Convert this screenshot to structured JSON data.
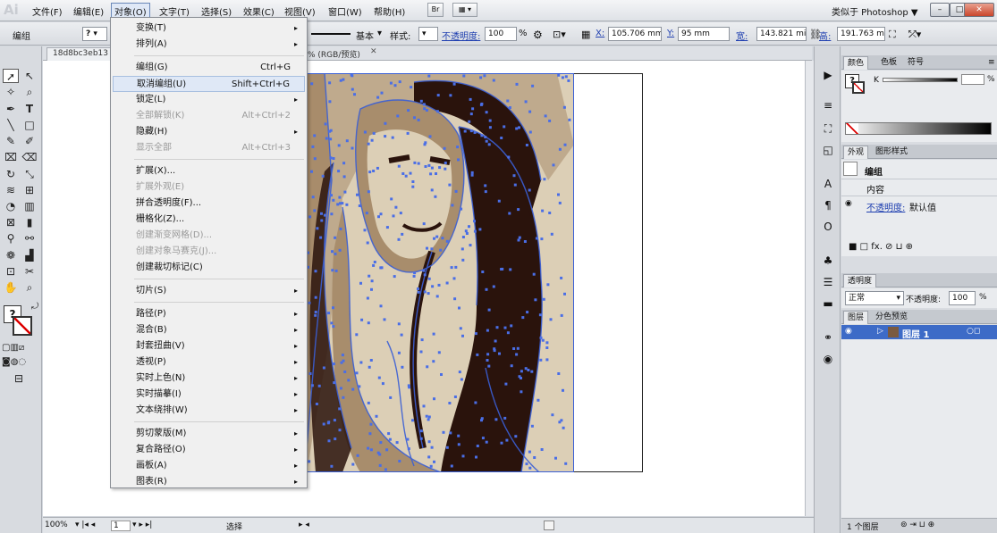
{
  "app": {
    "logo": "Ai",
    "workspace": "类似于 Photoshop ▼",
    "win_min": "–",
    "win_max": "□",
    "win_close": "✕"
  },
  "menubar": {
    "items": [
      "文件(F)",
      "编辑(E)",
      "对象(O)",
      "文字(T)",
      "选择(S)",
      "效果(C)",
      "视图(V)",
      "窗口(W)",
      "帮助(H)"
    ],
    "btn1": "Br",
    "btn2": "▦ ▾"
  },
  "control": {
    "group_label": "编组",
    "stroke_style": "基本",
    "style_label": "样式:",
    "opacity_label": "不透明度:",
    "opacity_value": "100",
    "opacity_unit": "%",
    "x_label": "X:",
    "x_value": "105.706 mm",
    "y_label": "Y:",
    "y_value": "95 mm",
    "w_label": "宽:",
    "w_value": "143.821 mi",
    "h_label": "高:",
    "h_value": "191.763 mi"
  },
  "document": {
    "tab_left": "18d8bc3eb13",
    "tab_right": "% (RGB/预览)",
    "tab_close": "✕"
  },
  "status": {
    "zoom": "100%",
    "page": "1",
    "mode": "选择"
  },
  "menu": {
    "items": [
      {
        "label": "变换(T)",
        "shortcut": "",
        "arrow": "▸",
        "state": "normal"
      },
      {
        "label": "排列(A)",
        "shortcut": "",
        "arrow": "▸",
        "state": "normal"
      },
      {
        "label": "编组(G)",
        "shortcut": "Ctrl+G",
        "arrow": "",
        "state": "normal"
      },
      {
        "label": "取消编组(U)",
        "shortcut": "Shift+Ctrl+G",
        "arrow": "",
        "state": "hi"
      },
      {
        "label": "锁定(L)",
        "shortcut": "",
        "arrow": "▸",
        "state": "normal"
      },
      {
        "label": "全部解锁(K)",
        "shortcut": "Alt+Ctrl+2",
        "arrow": "",
        "state": "dis"
      },
      {
        "label": "隐藏(H)",
        "shortcut": "",
        "arrow": "▸",
        "state": "normal"
      },
      {
        "label": "显示全部",
        "shortcut": "Alt+Ctrl+3",
        "arrow": "",
        "state": "dis"
      },
      {
        "label": "扩展(X)...",
        "shortcut": "",
        "arrow": "",
        "state": "normal"
      },
      {
        "label": "扩展外观(E)",
        "shortcut": "",
        "arrow": "",
        "state": "dis"
      },
      {
        "label": "拼合透明度(F)...",
        "shortcut": "",
        "arrow": "",
        "state": "normal"
      },
      {
        "label": "栅格化(Z)...",
        "shortcut": "",
        "arrow": "",
        "state": "normal"
      },
      {
        "label": "创建渐变网格(D)...",
        "shortcut": "",
        "arrow": "",
        "state": "dis"
      },
      {
        "label": "创建对象马赛克(J)...",
        "shortcut": "",
        "arrow": "",
        "state": "dis"
      },
      {
        "label": "创建裁切标记(C)",
        "shortcut": "",
        "arrow": "",
        "state": "normal"
      },
      {
        "label": "切片(S)",
        "shortcut": "",
        "arrow": "▸",
        "state": "normal"
      },
      {
        "label": "路径(P)",
        "shortcut": "",
        "arrow": "▸",
        "state": "normal"
      },
      {
        "label": "混合(B)",
        "shortcut": "",
        "arrow": "▸",
        "state": "normal"
      },
      {
        "label": "封套扭曲(V)",
        "shortcut": "",
        "arrow": "▸",
        "state": "normal"
      },
      {
        "label": "透视(P)",
        "shortcut": "",
        "arrow": "▸",
        "state": "normal"
      },
      {
        "label": "实时上色(N)",
        "shortcut": "",
        "arrow": "▸",
        "state": "normal"
      },
      {
        "label": "实时描摹(I)",
        "shortcut": "",
        "arrow": "▸",
        "state": "normal"
      },
      {
        "label": "文本绕排(W)",
        "shortcut": "",
        "arrow": "▸",
        "state": "normal"
      },
      {
        "label": "剪切蒙版(M)",
        "shortcut": "",
        "arrow": "▸",
        "state": "normal"
      },
      {
        "label": "复合路径(O)",
        "shortcut": "",
        "arrow": "▸",
        "state": "normal"
      },
      {
        "label": "画板(A)",
        "shortcut": "",
        "arrow": "▸",
        "state": "normal"
      },
      {
        "label": "图表(R)",
        "shortcut": "",
        "arrow": "▸",
        "state": "normal"
      }
    ]
  },
  "panels": {
    "color_tabs": [
      "颜色",
      "色板",
      "符号"
    ],
    "k_label": "K",
    "k_unit": "%",
    "appearance_tabs": [
      "外观",
      "图形样式"
    ],
    "appearance_group": "编组",
    "appearance_content": "内容",
    "appearance_opacity_label": "不透明度:",
    "appearance_opacity_value": "默认值",
    "transparency_tab": "透明度",
    "blend_mode": "正常",
    "tr_opacity_label": "不透明度:",
    "tr_opacity_value": "100",
    "tr_opacity_unit": "%",
    "layers_tabs": [
      "图层",
      "分色预览"
    ],
    "layer_name": "图层 1",
    "layer_count": "1 个图层"
  },
  "colors": {
    "accent": "#3a5fd6",
    "photo_light": "#dccfb6",
    "photo_mid": "#a88d6c",
    "photo_dark": "#2a130c"
  }
}
